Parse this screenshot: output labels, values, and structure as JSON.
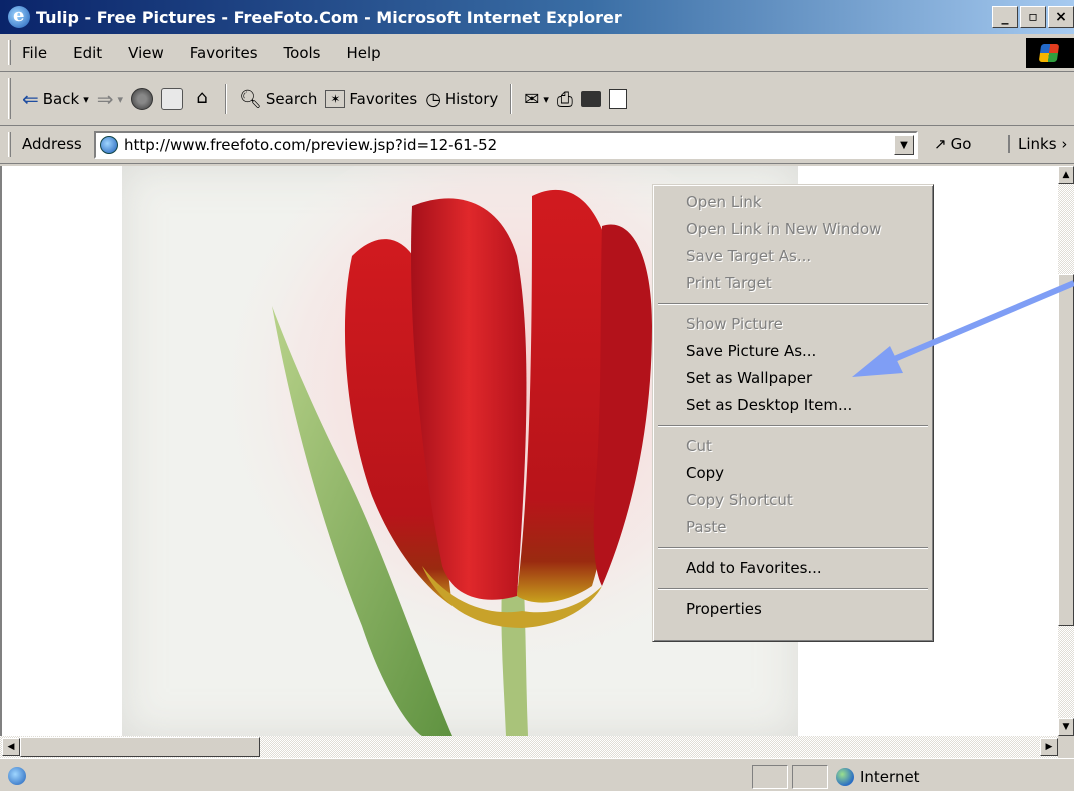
{
  "window": {
    "title": "Tulip - Free Pictures - FreeFoto.Com - Microsoft Internet Explorer",
    "minimize": "_",
    "maximize": "▫",
    "close": "×"
  },
  "menubar": {
    "items": [
      "File",
      "Edit",
      "View",
      "Favorites",
      "Tools",
      "Help"
    ]
  },
  "toolbar": {
    "back": "Back",
    "search": "Search",
    "favorites": "Favorites",
    "history": "History"
  },
  "address": {
    "label": "Address",
    "url": "http://www.freefoto.com/preview.jsp?id=12-61-52",
    "go": "Go",
    "links": "Links"
  },
  "context_menu": {
    "groups": [
      [
        {
          "label": "Open Link",
          "enabled": false
        },
        {
          "label": "Open Link in New Window",
          "enabled": false
        },
        {
          "label": "Save Target As...",
          "enabled": false
        },
        {
          "label": "Print Target",
          "enabled": false
        }
      ],
      [
        {
          "label": "Show Picture",
          "enabled": false
        },
        {
          "label": "Save Picture As...",
          "enabled": true
        },
        {
          "label": "Set as Wallpaper",
          "enabled": true
        },
        {
          "label": "Set as Desktop Item...",
          "enabled": true
        }
      ],
      [
        {
          "label": "Cut",
          "enabled": false
        },
        {
          "label": "Copy",
          "enabled": true
        },
        {
          "label": "Copy Shortcut",
          "enabled": false
        },
        {
          "label": "Paste",
          "enabled": false
        }
      ],
      [
        {
          "label": "Add to Favorites...",
          "enabled": true
        }
      ],
      [
        {
          "label": "Properties",
          "enabled": true
        }
      ]
    ]
  },
  "statusbar": {
    "zone": "Internet"
  },
  "colors": {
    "title_start": "#0a246a",
    "title_end": "#a6caf0",
    "chrome": "#d4d0c8",
    "annotation_arrow": "#7f9ef5",
    "tulip_red": "#c8141a"
  }
}
